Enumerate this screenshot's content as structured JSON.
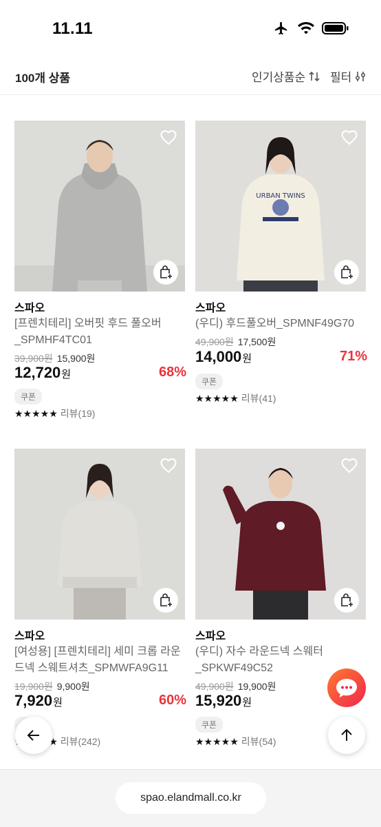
{
  "status": {
    "time": "11.11"
  },
  "toolbar": {
    "count": "100개 상품",
    "sort_label": "인기상품순",
    "filter_label": "필터"
  },
  "products": [
    {
      "brand": "스파오",
      "name": "[프렌치테리] 오버핏 후드 풀오버 _SPMHF4TC01",
      "orig_price": "39,900원",
      "sale_price": "15,900원",
      "final_price": "12,720",
      "won": "원",
      "discount": "68%",
      "coupon": "쿠폰",
      "stars": "★★★★★",
      "review": "리뷰(19)",
      "image_colors": {
        "bg": "#d9d9d6",
        "garment": "#b4b4b2"
      }
    },
    {
      "brand": "스파오",
      "name": "(우디) 후드풀오버_SPMNF49G70",
      "orig_price": "49,900원",
      "sale_price": "17,500원",
      "final_price": "14,000",
      "won": "원",
      "discount": "71%",
      "coupon": "쿠폰",
      "stars": "★★★★★",
      "review": "리뷰(41)",
      "image_colors": {
        "bg": "#dcdbd7",
        "garment": "#f1ede0"
      }
    },
    {
      "brand": "스파오",
      "name": "[여성용] [프렌치테리] 세미 크롭 라운드넥 스웨트셔츠_SPMWFA9G11",
      "orig_price": "19,900원",
      "sale_price": "9,900원",
      "final_price": "7,920",
      "won": "원",
      "discount": "60%",
      "coupon": "쿠폰",
      "stars": "★★★★★",
      "review": "리뷰(242)",
      "image_colors": {
        "bg": "#d8d8d5",
        "garment": "#dedcd6"
      }
    },
    {
      "brand": "스파오",
      "name": "(우디) 자수 라운드넥 스웨터 _SPKWF49C52",
      "orig_price": "49,900원",
      "sale_price": "19,900원",
      "final_price": "15,920",
      "won": "원",
      "discount": "",
      "coupon": "쿠폰",
      "stars": "★★★★★",
      "review": "리뷰(54)",
      "image_colors": {
        "bg": "#dcdbd8",
        "garment": "#5e1a24"
      }
    }
  ],
  "browser": {
    "url": "spao.elandmall.co.kr"
  },
  "colors": {
    "accent": "#e8343a",
    "chat_start": "#ff7a2f",
    "chat_end": "#f0264d"
  }
}
